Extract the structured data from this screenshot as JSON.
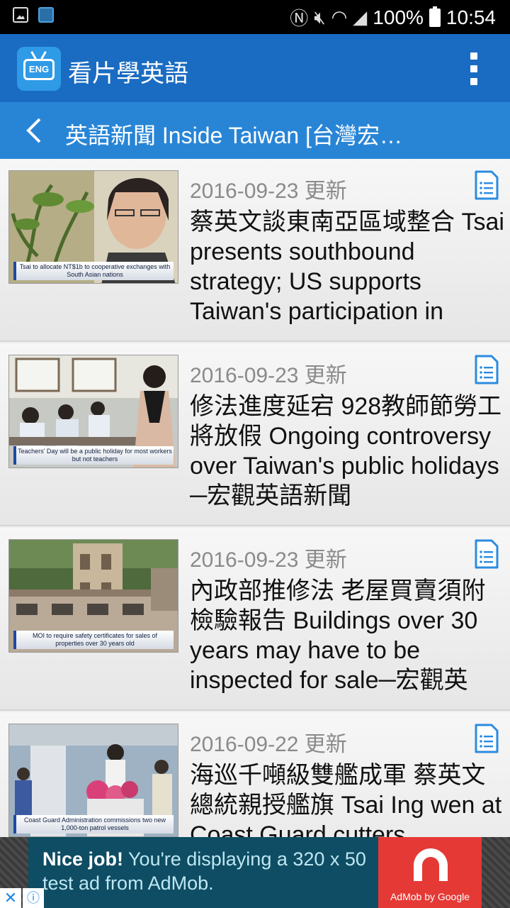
{
  "status_bar": {
    "battery": "100%",
    "time": "10:54"
  },
  "app_bar": {
    "title": "看片學英語",
    "logo_text": "ENG"
  },
  "sub_header": {
    "title": "英語新聞 Inside Taiwan [台灣宏…"
  },
  "news": [
    {
      "date": "2016-09-23 更新",
      "headline": "蔡英文談東南亞區域整合 Tsai presents southbound strategy; US supports Taiwan's participation in",
      "caption": "Tsai to allocate NT$1b to cooperative exchanges with South Asian nations"
    },
    {
      "date": "2016-09-23 更新",
      "headline": "修法進度延宕 928教師節勞工將放假 Ongoing controversy over Taiwan's public holidays ─宏觀英語新聞",
      "caption": "Teachers' Day will be a public holiday for most workers but not teachers"
    },
    {
      "date": "2016-09-23 更新",
      "headline": "內政部推修法 老屋買賣須附檢驗報告 Buildings over 30 years may have to be inspected for sale─宏觀英",
      "caption": "MOI to require safety certificates for sales of properties over 30 years old"
    },
    {
      "date": "2016-09-22 更新",
      "headline": "海巡千噸級雙艦成軍 蔡英文總統親授艦旗 Tsai Ing wen at Coast Guard cutters",
      "caption": "Coast Guard Administration commissions two new 1,000-ton patrol vessels"
    }
  ],
  "ad": {
    "bold": "Nice job!",
    "text": " You're displaying a 320 x 50 test ad from AdMob.",
    "brand": "AdMob by Google",
    "close": "✕",
    "info": "ⓘ"
  }
}
